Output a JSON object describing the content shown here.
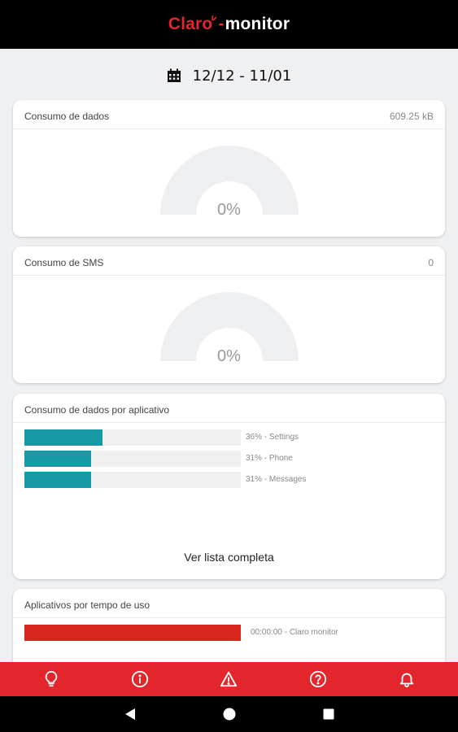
{
  "header": {
    "brand": "Claro",
    "separator": "-",
    "product": "monitor"
  },
  "period": {
    "icon": "calendar-icon",
    "text": "12/12 - 11/01"
  },
  "data_card": {
    "title": "Consumo de dados",
    "value": "609.25 kB",
    "percent_text": "0%",
    "percent": 0
  },
  "sms_card": {
    "title": "Consumo de SMS",
    "value": "0",
    "percent_text": "0%",
    "percent": 0
  },
  "apps_card": {
    "title": "Consumo de dados por aplicativo",
    "bar_color": "#1799a6",
    "items": [
      {
        "label": "36% - Settings",
        "percent": 36
      },
      {
        "label": "31% - Phone",
        "percent": 31
      },
      {
        "label": "31% - Messages",
        "percent": 31
      }
    ],
    "see_all": "Ver lista completa"
  },
  "time_card": {
    "title": "Aplicativos por tempo de uso",
    "bar_color": "#d8261f",
    "items": [
      {
        "label": "00:00:00 - Claro monitor",
        "percent": 100
      }
    ]
  },
  "bottom_nav": {
    "background": "#e3262b",
    "items": [
      "lightbulb-icon",
      "info-icon",
      "warning-icon",
      "help-icon",
      "bell-icon"
    ]
  },
  "system_nav": [
    "back-icon",
    "home-icon",
    "recents-icon"
  ]
}
